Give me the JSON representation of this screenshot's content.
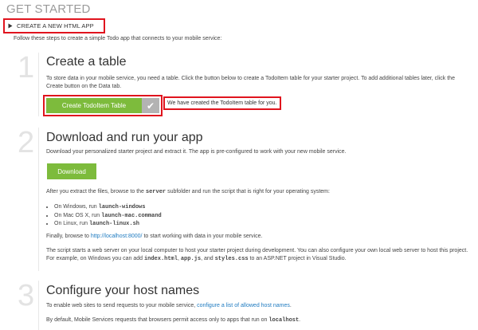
{
  "page": {
    "title": "GET STARTED"
  },
  "section": {
    "label": "CREATE A NEW HTML APP"
  },
  "intro": "Follow these steps to create a simple Todo app that connects to your mobile service:",
  "steps": [
    {
      "number": "1",
      "heading": "Create a table",
      "text": "To store data in your mobile service, you need a table. Click the button below to create a TodoItem table for your starter project. To add additional tables later, click the Create button on the Data tab.",
      "button_label": "Create TodoItem Table",
      "confirmation": "We have created the TodoItem table for you."
    },
    {
      "number": "2",
      "heading": "Download and run your app",
      "text": "Download your personalized starter project and extract it. The app is pre-configured to work with your new mobile service.",
      "button_label": "Download",
      "after_extract_pre": "After you extract the files, browse to the ",
      "after_extract_code": "server",
      "after_extract_post": " subfolder and run the script that is right for your operating system:",
      "os_list": [
        {
          "pre": "On Windows, run ",
          "code": "launch-windows"
        },
        {
          "pre": "On Mac OS X, run ",
          "code": "launch-mac.command"
        },
        {
          "pre": "On Linux, run ",
          "code": "launch-linux.sh"
        }
      ],
      "finally_pre": "Finally, browse to ",
      "finally_link": "http://localhost:8000/",
      "finally_post": " to start working with data in your mobile service.",
      "server_pre": "The script starts a web server on your local computer to host your starter project during development. You can also configure your own local web server to host this project. For example, on Windows you can add ",
      "server_code1": "index.html",
      "server_sep1": ", ",
      "server_code2": "app.js",
      "server_sep2": ", and ",
      "server_code3": "styles.css",
      "server_post": " to an ASP.NET project in Visual Studio."
    },
    {
      "number": "3",
      "heading": "Configure your host names",
      "text_pre": "To enable web sites to send requests to your mobile service, ",
      "text_link": "configure a list of allowed host names",
      "text_post": ".",
      "default_pre": "By default, Mobile Services requests that browsers permit access only to apps that run on ",
      "default_code": "localhost",
      "default_post": "."
    }
  ],
  "colors": {
    "accent_green": "#7dbb3c",
    "highlight_red": "#e0141e",
    "link_blue": "#1f7bc0"
  }
}
